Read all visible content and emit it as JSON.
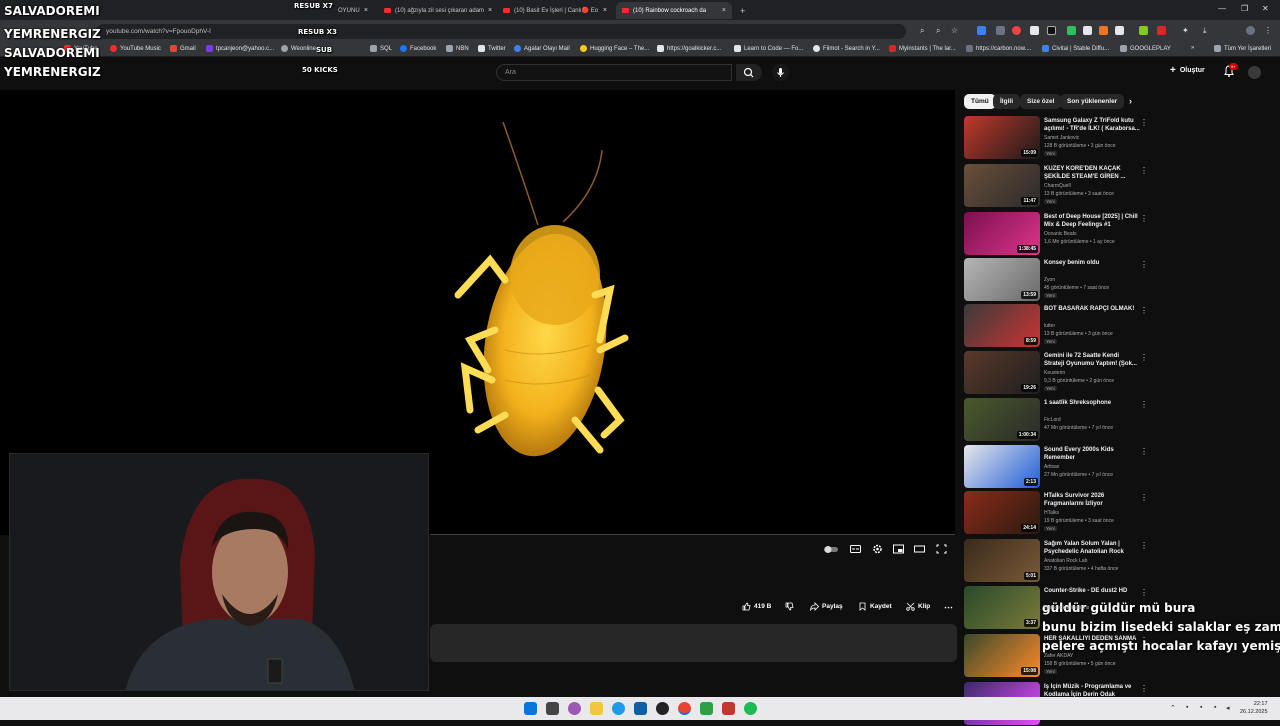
{
  "browser": {
    "tabs": [
      {
        "label": "OYUNU"
      },
      {
        "label": "(10) ağzıyla zil sesi çıkaran adam"
      },
      {
        "label": "(10) Basit Ev İşleri | Canlı🔴 Eo"
      },
      {
        "label": "(10) Rainbow cockroach da"
      }
    ],
    "url": "youtube.com/watch?v=FpouoDphV-I",
    "bookmarks": [
      "YouTube",
      "YouTube Music",
      "Gmail",
      "tpcanjeon@yahoo.c...",
      "Weonline",
      "SQL",
      "Facebook",
      "NBN",
      "Twitter",
      "Agalar Olayı Mail",
      "Hugging Face – The...",
      "https://goalkicker.c...",
      "Learn to Code — Fo...",
      "Filmot - Search in Y...",
      "Myinstants | The lar...",
      "https://carbon.now....",
      "Civitai | Stable Diffu...",
      "GOOGLEPLAY"
    ],
    "all_bookmarks": "Tüm Yer İşaretleri",
    "colors": {
      "chrome": "#35363a",
      "tab_bg": "#202124"
    }
  },
  "youtube": {
    "search_placeholder": "Ara",
    "create_label": "Oluştur",
    "notif_count": "9+",
    "chips": [
      "Tümü",
      "İlgili",
      "Size özel",
      "Son yüklenenler"
    ],
    "actions": {
      "like_count": "419 B",
      "share": "Paylaş",
      "save": "Kaydet",
      "clip": "Klip"
    },
    "recommendations": [
      {
        "title": "Samsung Galaxy Z TriFold kutu açılımı! - TR'de İLK! ( Karaborsa...",
        "channel": "Samet Jankovic",
        "meta": "128 B görüntüleme • 3 gün önce",
        "duration": "15:09",
        "badge": "Yeni"
      },
      {
        "title": "KUZEY KORE'DEN KAÇAK ŞEKİLDE STEAM'E GİREN ...",
        "channel": "CharmQuell",
        "meta": "13 B görüntüleme • 3 saat önce",
        "duration": "11:47",
        "badge": "Yeni"
      },
      {
        "title": "Best of Deep House [2025] | Chill Mix & Deep Feelings #1",
        "channel": "Oceanic Beats",
        "meta": "1,6 Mn görüntüleme • 1 ay önce",
        "duration": "1:38:45",
        "badge": ""
      },
      {
        "title": "Konsey benim oldu",
        "channel": "Zyon",
        "meta": "45 görüntüleme • 7 saat önce",
        "duration": "13:59",
        "badge": "Yeni"
      },
      {
        "title": "BOT BASARAK RAPÇİ OLMAK!",
        "channel": "lutter",
        "meta": "13 B görüntüleme • 3 gün önce",
        "duration": "8:59",
        "badge": "Yeni"
      },
      {
        "title": "Gemini ile 72 Saatte Kendi Strateji Oyunumu Yaptım! (Şok...",
        "channel": "Keusterin",
        "meta": "9,3 B görüntüleme • 2 gün önce",
        "duration": "19:26",
        "badge": "Yeni"
      },
      {
        "title": "1 saatlik Shreksophone",
        "channel": "FicLord",
        "meta": "47 Mn görüntüleme • 7 yıl önce",
        "duration": "1:00:34",
        "badge": ""
      },
      {
        "title": "Sound Every 2000s Kids Remember",
        "channel": "Artisax",
        "meta": "27 Mn görüntüleme • 7 yıl önce",
        "duration": "2:13",
        "badge": ""
      },
      {
        "title": "HTalks Survivor 2026 Fragmanlarını İzliyor",
        "channel": "HTalks",
        "meta": "19 B görüntüleme • 3 saat önce",
        "duration": "24:14",
        "badge": "Yeni"
      },
      {
        "title": "Sağım Yalan Solum Yalan | Psychedelic Anatolian Rock",
        "channel": "Anatolian Rock Lab",
        "meta": "337 B görüntüleme • 4 hafta önce",
        "duration": "5:01",
        "badge": ""
      },
      {
        "title": "Counter-Strike - DE dust2 HD",
        "channel": "flashdeckanimations",
        "meta": "",
        "duration": "3:37",
        "badge": ""
      },
      {
        "title": "HER SAKALLIYI DEDEN SANMA",
        "channel": "Zafer AKDAY",
        "meta": "158 B görüntüleme • 5 gün önce",
        "duration": "15:08",
        "badge": "Yeni"
      },
      {
        "title": "İş İçin Müzik - Programlama ve Kodlama İçin Derin Odak",
        "channel": "",
        "meta": "",
        "duration": "",
        "badge": ""
      }
    ]
  },
  "overlay": {
    "names": [
      "SALVADOREMI",
      "YEMRENERGIZ",
      "SALVADOREMI",
      "YEMRENERGIZ"
    ],
    "events": [
      "RESUB X7",
      "RESUB X3",
      "SUB",
      "50 KICKS"
    ],
    "chat": [
      "güldür güldür mü bura",
      "bunu bizim lisedeki salaklar eş zamanlı bütü",
      "pelere açmıştı hocalar kafayı yemişti ya"
    ]
  },
  "taskbar": {
    "time": "22:17",
    "date": "26.12.2025"
  }
}
